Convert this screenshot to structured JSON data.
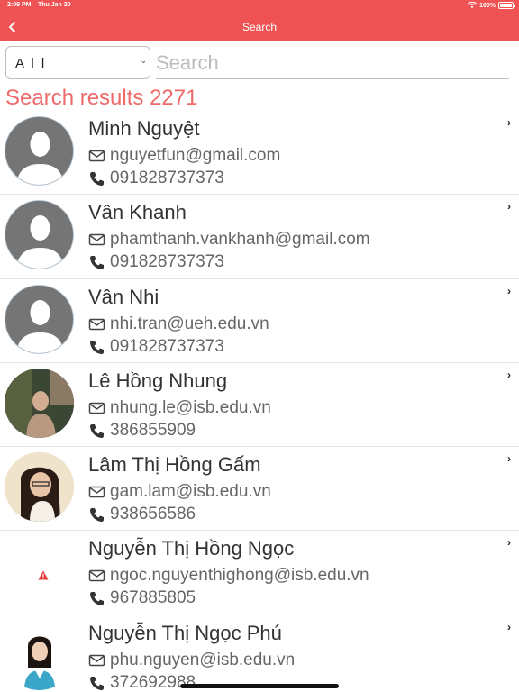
{
  "status_bar": {
    "time": "2:09 PM",
    "date": "Thu Jan 20",
    "battery": "100%"
  },
  "header": {
    "title": "Search",
    "accent_color": "#ee5252"
  },
  "filter": {
    "selected": "A l l"
  },
  "search": {
    "placeholder": "Search",
    "value": ""
  },
  "results": {
    "label": "Search results 2271"
  },
  "contacts": [
    {
      "name": "Minh Nguyệt",
      "email": "nguyetfun@gmail.com",
      "phone": "091828737373",
      "avatar": "default"
    },
    {
      "name": "Vân Khanh",
      "email": "phamthanh.vankhanh@gmail.com",
      "phone": "091828737373",
      "avatar": "default"
    },
    {
      "name": "Vân Nhi",
      "email": "nhi.tran@ueh.edu.vn",
      "phone": "091828737373",
      "avatar": "default"
    },
    {
      "name": "Lê Hồng Nhung",
      "email": "nhung.le@isb.edu.vn",
      "phone": "386855909",
      "avatar": "photo"
    },
    {
      "name": "Lâm Thị Hồng Gấm",
      "email": "gam.lam@isb.edu.vn",
      "phone": "938656586",
      "avatar": "photo"
    },
    {
      "name": "Nguyễn Thị Hồng Ngọc",
      "email": "ngoc.nguyenthighong@isb.edu.vn",
      "phone": "967885805",
      "avatar": "broken-image"
    },
    {
      "name": "Nguyễn Thị Ngọc Phú",
      "email": "phu.nguyen@isb.edu.vn",
      "phone": "372692988",
      "avatar": "photo"
    }
  ]
}
